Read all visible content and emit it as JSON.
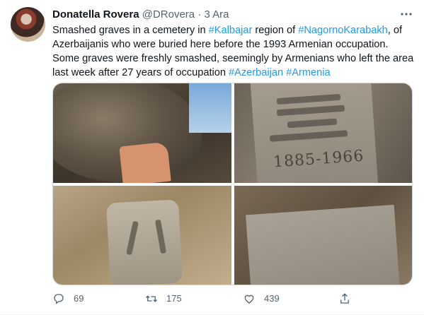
{
  "tweet": {
    "author_name": "Donatella Rovera",
    "author_handle": "@DRovera",
    "separator": "·",
    "date": "3 Ara",
    "more_icon": "more-horizontal-icon",
    "text_segments": [
      {
        "text": "Smashed graves in a cemetery in ",
        "tag": false
      },
      {
        "text": "#Kalbajar",
        "tag": true
      },
      {
        "text": " region of ",
        "tag": false
      },
      {
        "text": "#NagornoKarabakh",
        "tag": true
      },
      {
        "text": ", of Azerbaijanis who were buried here before the 1993 Armenian occupation. Some graves were freshly smashed, seemingly by Armenians who left the area last week after 27 years of occupation ",
        "tag": false
      },
      {
        "text": "#Azerbaijan",
        "tag": true
      },
      {
        "text": " ",
        "tag": false
      },
      {
        "text": "#Armenia",
        "tag": true
      }
    ],
    "photos": [
      {
        "name": "photo-gravestone-rock"
      },
      {
        "name": "photo-engraved-slab",
        "engraving_dates": "1885-1966"
      },
      {
        "name": "photo-broken-slab"
      },
      {
        "name": "photo-smashed-grave"
      }
    ]
  },
  "actions": {
    "reply_count": "69",
    "retweet_count": "175",
    "like_count": "439",
    "link_color": "#1d9bf0",
    "muted_color": "#536471"
  }
}
